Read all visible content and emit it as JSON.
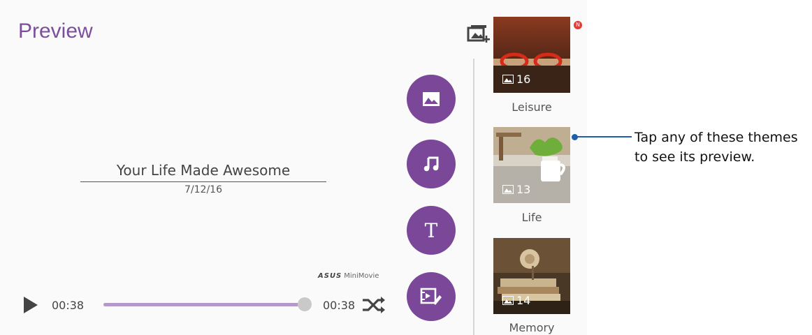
{
  "header": {
    "title": "Preview",
    "badge": "N"
  },
  "icons": {
    "add_image": "add-image-icon",
    "save": "save-icon",
    "more": "more-vert-icon",
    "play": "play-icon",
    "shuffle": "shuffle-icon",
    "image": "image-icon",
    "music": "music-note-icon",
    "text": "T",
    "edit": "video-edit-icon"
  },
  "video": {
    "title": "Your Life Made Awesome",
    "date": "7/12/16",
    "brand": "ASUS",
    "product": "MiniMovie"
  },
  "player": {
    "current_time": "00:38",
    "total_time": "00:38",
    "progress": 1.0
  },
  "themes": [
    {
      "label": "Leisure",
      "count": "16"
    },
    {
      "label": "Life",
      "count": "13"
    },
    {
      "label": "Memory",
      "count": "14"
    }
  ],
  "callout": {
    "text": "Tap any of these themes to see its preview."
  },
  "colors": {
    "accent": "#7b4899",
    "title": "#7b4f9c",
    "callout": "#1e5fa8"
  }
}
